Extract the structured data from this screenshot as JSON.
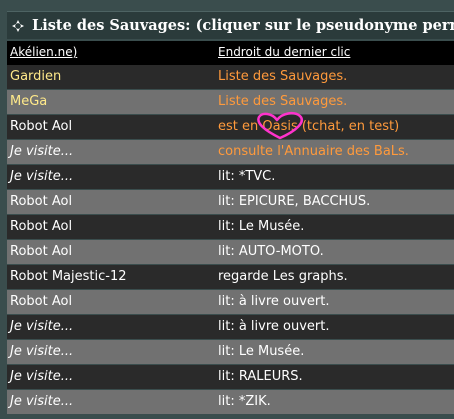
{
  "header": {
    "title": "Liste des Sauvages: (cliquer sur le pseudonyme permet"
  },
  "columns": {
    "col1": "Akélien.ne)",
    "col2": "Endroit du dernier clic"
  },
  "rows": [
    {
      "name": "Gardien",
      "place": "Liste des Sauvages."
    },
    {
      "name": "MeGa",
      "place": "Liste des Sauvages."
    },
    {
      "name": "Robot Aol",
      "place": "est en Oasis (tchat, en test)"
    },
    {
      "name": "Je visite...",
      "place": "consulte l'Annuaire des BaLs."
    },
    {
      "name": "Je visite...",
      "place": "lit: *TVC."
    },
    {
      "name": "Robot Aol",
      "place": "lit: EPICURE, BACCHUS."
    },
    {
      "name": "Robot Aol",
      "place": "lit: Le Musée."
    },
    {
      "name": "Robot Aol",
      "place": "lit: AUTO-MOTO."
    },
    {
      "name": "Robot Majestic-12",
      "place": "regarde Les graphs."
    },
    {
      "name": "Robot Aol",
      "place": "lit: à livre ouvert."
    },
    {
      "name": "Je visite...",
      "place": "lit: à livre ouvert."
    },
    {
      "name": "Je visite...",
      "place": "lit: Le Musée."
    },
    {
      "name": "Je visite...",
      "place": "lit: RALEURS."
    },
    {
      "name": "Je visite...",
      "place": "lit: *ZIK."
    }
  ],
  "colors": {
    "header_bg": "#2b3b3b",
    "column_header_bg": "#000000",
    "row_dark": "#2a2a2a",
    "row_light": "#717171",
    "staff_name": "#ffe98a",
    "highlight_place": "#ff9a3c",
    "scribble": "#ff33cc"
  },
  "icons": {
    "header": "diamond-arrows-icon",
    "annotation": "heart-scribble"
  }
}
